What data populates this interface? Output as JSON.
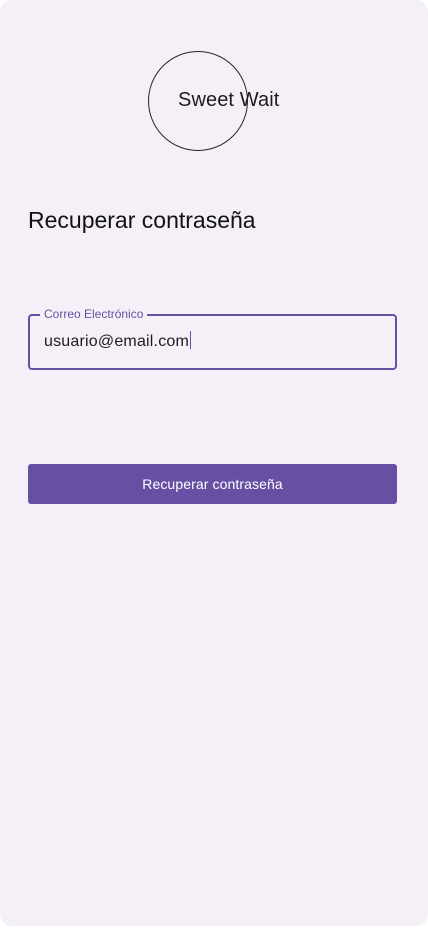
{
  "app": {
    "logo_text": "Sweet Wait"
  },
  "page": {
    "title": "Recuperar contraseña"
  },
  "form": {
    "email_field": {
      "label": "Correo Electrónico",
      "value": "usuario@email.com"
    },
    "submit_label": "Recuperar contraseña"
  },
  "colors": {
    "background": "#f5f0f7",
    "accent": "#6750a4",
    "button_text": "#ffffff"
  }
}
